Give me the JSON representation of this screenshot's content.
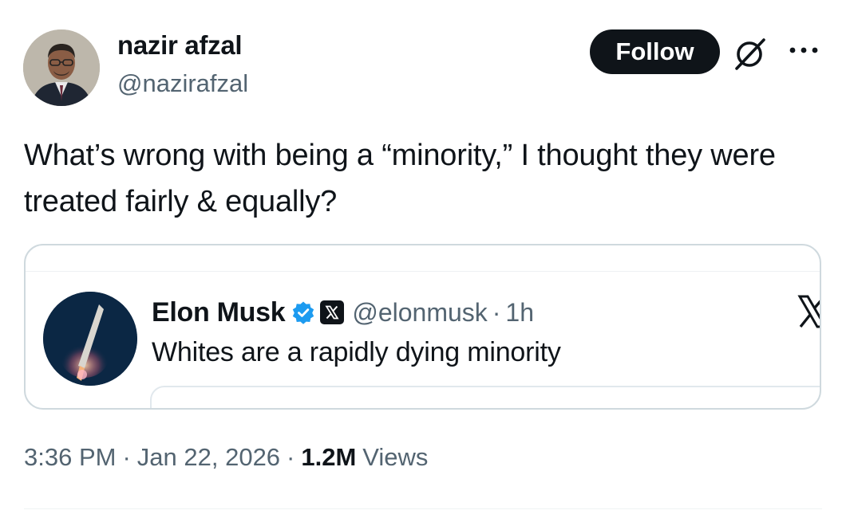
{
  "tweet": {
    "author_name": "nazir afzal",
    "author_handle": "@nazirafzal",
    "follow_label": "Follow",
    "text": "What’s wrong with being a “minority,” I thought they were treated fairly & equally?",
    "time": "3:36 PM",
    "date": "Jan 22, 2026",
    "views_count": "1.2M",
    "views_label": "Views",
    "separator": "·"
  },
  "quote": {
    "name": "Elon Musk",
    "handle": "@elonmusk",
    "separator": "·",
    "time": "1h",
    "text": "Whites are a rapidly dying minority"
  },
  "icons": {
    "grok": "grok-icon",
    "more": "more-icon",
    "verified": "verified-icon",
    "x_badge": "x-logo-badge-icon",
    "x_logo": "x-logo-icon"
  },
  "colors": {
    "text": "#0f1419",
    "secondary": "#536471",
    "verified": "#1d9bf0",
    "border": "#cfd9de",
    "button_bg": "#0f1419"
  }
}
